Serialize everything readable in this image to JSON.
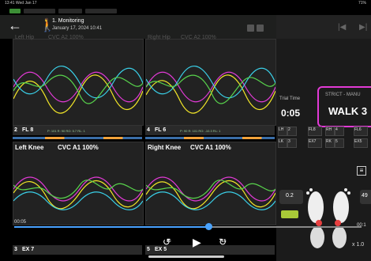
{
  "status": {
    "time": "13:41  Wed Jan 17",
    "right": "71%"
  },
  "header": {
    "title": "1. Monitoring",
    "subtitle": "January 17, 2024 10:41"
  },
  "plots": [
    {
      "ghost_left": "Left Hip",
      "ghost_label": "CVC A2 100%",
      "info_num": "2",
      "info_tag": "FL 8",
      "info_metrics": "P: 101  R: 90  RO: 5.7  RL: 1"
    },
    {
      "ghost_left": "Right Hip",
      "ghost_label": "CVC A2 100%",
      "info_num": "4",
      "info_tag": "FL 6",
      "info_metrics": "P: 90  R: 101  RO: -10.3  RL: 1"
    },
    {
      "title": "Left Knee",
      "label": "CVC A1 100%",
      "info_num": "3",
      "info_tag": "EX 7"
    },
    {
      "title": "Right Knee",
      "label": "CVC A1 100%",
      "info_num": "5",
      "info_tag": "EX 5"
    }
  ],
  "right": {
    "trial_label": "Trial Time",
    "trial_time": "0:05",
    "mode_label": "STRICT - MANU",
    "mode_value": "WALK 3",
    "grid": [
      [
        "LH",
        "2",
        "FL8"
      ],
      [
        "RH",
        "4",
        "FL6"
      ],
      [
        "LK",
        "3",
        "EX7"
      ],
      [
        "RK",
        "5",
        "EX5"
      ]
    ],
    "value_left": "0.2",
    "value_right": "49",
    "speed": "x 1.0",
    "time_right": "00:1"
  },
  "playback": {
    "current": "00:05",
    "skip_back": "15",
    "skip_fwd": "15"
  },
  "colors": {
    "magenta": "#e23ad6",
    "yellow": "#f2e628",
    "cyan": "#3ad0e8",
    "green": "#58d34c",
    "orange": "#f2a23a"
  }
}
